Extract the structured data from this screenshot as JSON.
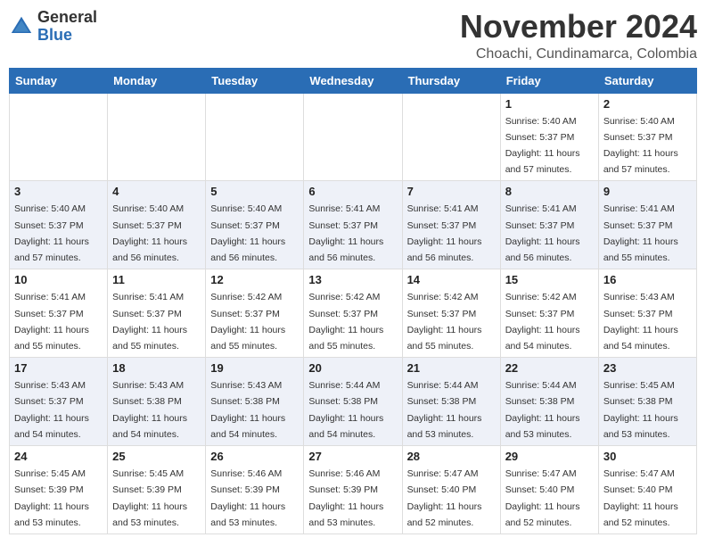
{
  "header": {
    "logo_general": "General",
    "logo_blue": "Blue",
    "month_title": "November 2024",
    "location": "Choachi, Cundinamarca, Colombia"
  },
  "days_of_week": [
    "Sunday",
    "Monday",
    "Tuesday",
    "Wednesday",
    "Thursday",
    "Friday",
    "Saturday"
  ],
  "weeks": [
    [
      {
        "day": "",
        "info": ""
      },
      {
        "day": "",
        "info": ""
      },
      {
        "day": "",
        "info": ""
      },
      {
        "day": "",
        "info": ""
      },
      {
        "day": "",
        "info": ""
      },
      {
        "day": "1",
        "info": "Sunrise: 5:40 AM\nSunset: 5:37 PM\nDaylight: 11 hours and 57 minutes."
      },
      {
        "day": "2",
        "info": "Sunrise: 5:40 AM\nSunset: 5:37 PM\nDaylight: 11 hours and 57 minutes."
      }
    ],
    [
      {
        "day": "3",
        "info": "Sunrise: 5:40 AM\nSunset: 5:37 PM\nDaylight: 11 hours and 57 minutes."
      },
      {
        "day": "4",
        "info": "Sunrise: 5:40 AM\nSunset: 5:37 PM\nDaylight: 11 hours and 56 minutes."
      },
      {
        "day": "5",
        "info": "Sunrise: 5:40 AM\nSunset: 5:37 PM\nDaylight: 11 hours and 56 minutes."
      },
      {
        "day": "6",
        "info": "Sunrise: 5:41 AM\nSunset: 5:37 PM\nDaylight: 11 hours and 56 minutes."
      },
      {
        "day": "7",
        "info": "Sunrise: 5:41 AM\nSunset: 5:37 PM\nDaylight: 11 hours and 56 minutes."
      },
      {
        "day": "8",
        "info": "Sunrise: 5:41 AM\nSunset: 5:37 PM\nDaylight: 11 hours and 56 minutes."
      },
      {
        "day": "9",
        "info": "Sunrise: 5:41 AM\nSunset: 5:37 PM\nDaylight: 11 hours and 55 minutes."
      }
    ],
    [
      {
        "day": "10",
        "info": "Sunrise: 5:41 AM\nSunset: 5:37 PM\nDaylight: 11 hours and 55 minutes."
      },
      {
        "day": "11",
        "info": "Sunrise: 5:41 AM\nSunset: 5:37 PM\nDaylight: 11 hours and 55 minutes."
      },
      {
        "day": "12",
        "info": "Sunrise: 5:42 AM\nSunset: 5:37 PM\nDaylight: 11 hours and 55 minutes."
      },
      {
        "day": "13",
        "info": "Sunrise: 5:42 AM\nSunset: 5:37 PM\nDaylight: 11 hours and 55 minutes."
      },
      {
        "day": "14",
        "info": "Sunrise: 5:42 AM\nSunset: 5:37 PM\nDaylight: 11 hours and 55 minutes."
      },
      {
        "day": "15",
        "info": "Sunrise: 5:42 AM\nSunset: 5:37 PM\nDaylight: 11 hours and 54 minutes."
      },
      {
        "day": "16",
        "info": "Sunrise: 5:43 AM\nSunset: 5:37 PM\nDaylight: 11 hours and 54 minutes."
      }
    ],
    [
      {
        "day": "17",
        "info": "Sunrise: 5:43 AM\nSunset: 5:37 PM\nDaylight: 11 hours and 54 minutes."
      },
      {
        "day": "18",
        "info": "Sunrise: 5:43 AM\nSunset: 5:38 PM\nDaylight: 11 hours and 54 minutes."
      },
      {
        "day": "19",
        "info": "Sunrise: 5:43 AM\nSunset: 5:38 PM\nDaylight: 11 hours and 54 minutes."
      },
      {
        "day": "20",
        "info": "Sunrise: 5:44 AM\nSunset: 5:38 PM\nDaylight: 11 hours and 54 minutes."
      },
      {
        "day": "21",
        "info": "Sunrise: 5:44 AM\nSunset: 5:38 PM\nDaylight: 11 hours and 53 minutes."
      },
      {
        "day": "22",
        "info": "Sunrise: 5:44 AM\nSunset: 5:38 PM\nDaylight: 11 hours and 53 minutes."
      },
      {
        "day": "23",
        "info": "Sunrise: 5:45 AM\nSunset: 5:38 PM\nDaylight: 11 hours and 53 minutes."
      }
    ],
    [
      {
        "day": "24",
        "info": "Sunrise: 5:45 AM\nSunset: 5:39 PM\nDaylight: 11 hours and 53 minutes."
      },
      {
        "day": "25",
        "info": "Sunrise: 5:45 AM\nSunset: 5:39 PM\nDaylight: 11 hours and 53 minutes."
      },
      {
        "day": "26",
        "info": "Sunrise: 5:46 AM\nSunset: 5:39 PM\nDaylight: 11 hours and 53 minutes."
      },
      {
        "day": "27",
        "info": "Sunrise: 5:46 AM\nSunset: 5:39 PM\nDaylight: 11 hours and 53 minutes."
      },
      {
        "day": "28",
        "info": "Sunrise: 5:47 AM\nSunset: 5:40 PM\nDaylight: 11 hours and 52 minutes."
      },
      {
        "day": "29",
        "info": "Sunrise: 5:47 AM\nSunset: 5:40 PM\nDaylight: 11 hours and 52 minutes."
      },
      {
        "day": "30",
        "info": "Sunrise: 5:47 AM\nSunset: 5:40 PM\nDaylight: 11 hours and 52 minutes."
      }
    ]
  ]
}
